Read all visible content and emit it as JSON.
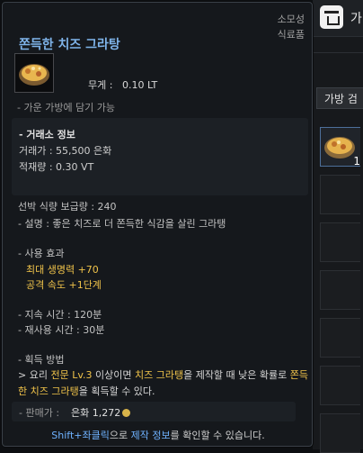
{
  "tooltip": {
    "item_name": "쫀득한 치즈 그라탕",
    "category_line1": "소모성",
    "category_line2": "식료품",
    "weight_label": "무게 :",
    "weight_value": "0.10 LT",
    "bag_info": "- 가운 가방에 담기 가능",
    "market": {
      "heading": "- 거래소 정보",
      "price": "거래가 : 55,500 은화",
      "load": "적재량 : 0.30 VT"
    },
    "ship_food": "선박 식량 보급량 : 240",
    "description": "- 설명 : 좋은 치즈로 더 쫀득한 식감을 살린 그라탱",
    "use_effect_heading": "- 사용 효과",
    "effects": [
      "최대 생명력 +70",
      "공격 속도 +1단계"
    ],
    "duration": "- 지속 시간 : 120분",
    "cooldown": "- 재사용 시간 : 30분",
    "acquire_heading": "- 획득 방법",
    "acquire_parts": [
      "> 요리 ",
      "전문 Lv.3",
      " 이상이면 ",
      "치즈 그라탱",
      "을 제작할 때 낮은 확률로 ",
      "쫀득한 치즈 그라탱",
      "을 획득할 수 있다."
    ],
    "sell_label": "- 판매가 :",
    "sell_value": "은화 1,272",
    "hint_parts": [
      "Shift+좌클릭",
      "으로 ",
      "제작 정보",
      "를 확인할 수 있습니다."
    ]
  },
  "inventory": {
    "top_letter": "가",
    "bag_search": "가방 검",
    "slot_qty": "1"
  },
  "colors": {
    "title": "#7fb4ea",
    "effect": "#f0c34a",
    "hint_blue": "#6fb2ff"
  }
}
